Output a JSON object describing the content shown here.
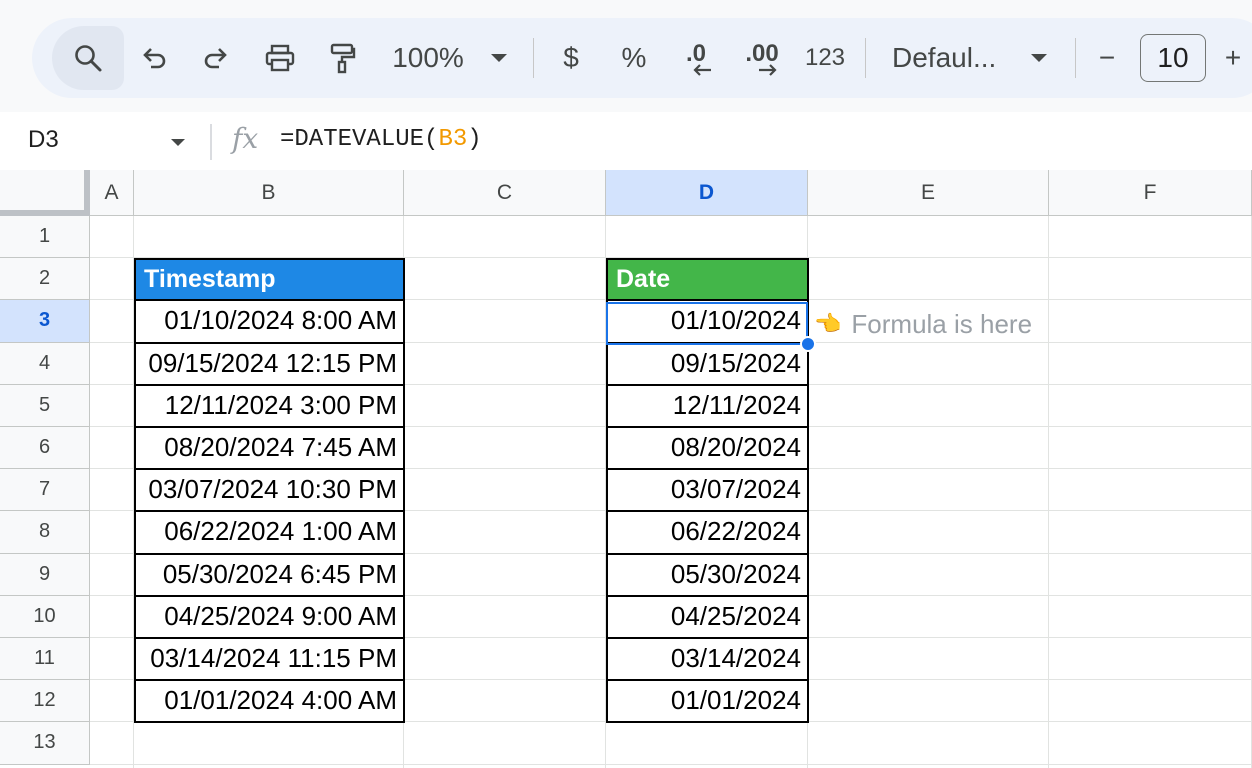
{
  "toolbar": {
    "zoom": "100%",
    "currency": "$",
    "percent": "%",
    "decrease_decimal": ".0",
    "increase_decimal": ".00",
    "more_formats": "123",
    "font_family": "Defaul...",
    "font_size": "10",
    "minus": "−",
    "plus": "+",
    "icons": [
      "search-icon",
      "undo-icon",
      "redo-icon",
      "print-icon",
      "paint-format-icon",
      "chevron-down-icon"
    ]
  },
  "formula_bar": {
    "name_box": "D3",
    "fx": "fx",
    "formula_prefix": "=DATEVALUE(",
    "formula_ref": "B3",
    "formula_suffix": ")"
  },
  "columns": [
    "A",
    "B",
    "C",
    "D",
    "E",
    "F"
  ],
  "rows": [
    "1",
    "2",
    "3",
    "4",
    "5",
    "6",
    "7",
    "8",
    "9",
    "10",
    "11",
    "12",
    "13"
  ],
  "selected_cell": "D3",
  "table_b": {
    "header": "Timestamp",
    "values": [
      "01/10/2024 8:00 AM",
      "09/15/2024 12:15 PM",
      "12/11/2024 3:00 PM",
      "08/20/2024 7:45 AM",
      "03/07/2024 10:30 PM",
      "06/22/2024 1:00 AM",
      "05/30/2024 6:45 PM",
      "04/25/2024 9:00 AM",
      "03/14/2024 11:15 PM",
      "01/01/2024 4:00 AM"
    ]
  },
  "table_d": {
    "header": "Date",
    "values": [
      "01/10/2024",
      "09/15/2024",
      "12/11/2024",
      "08/20/2024",
      "03/07/2024",
      "06/22/2024",
      "05/30/2024",
      "04/25/2024",
      "03/14/2024",
      "01/01/2024"
    ]
  },
  "note": {
    "hand": "👈",
    "text": "Formula is here"
  },
  "colors": {
    "timestamp_header": "#1e88e5",
    "date_header": "#43b649",
    "selection": "#1a73e8",
    "formula_ref": "#f29900"
  }
}
